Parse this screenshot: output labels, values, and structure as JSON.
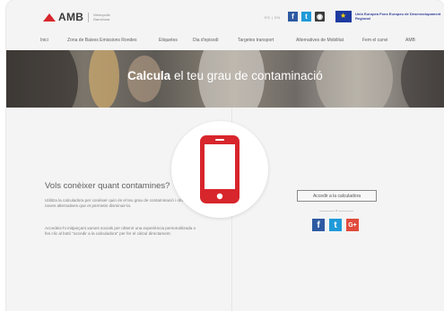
{
  "header": {
    "logo_text": "AMB",
    "logo_sub": "Metropolis Barcelona",
    "lang": "ES | EN",
    "eu_text": "Unió Europea Fons Europeu de Desenvolupament Regional"
  },
  "nav": {
    "items": [
      "Inici",
      "Zona de Baixes Emissions Rondes",
      "Etiquetes",
      "Dia d'episodi",
      "Targetes transport",
      "Alternatives de Mobilitat",
      "Fem el canvi",
      "AMB"
    ]
  },
  "hero": {
    "title_bold": "Calcula",
    "title_rest": " el teu grau de contaminació"
  },
  "content": {
    "title": "Vols conèixer quant contamines?",
    "para1": "Utilitza la calculadora per conèixer quin és el teu grau de contaminació i obtenir noves alternatives que et permetin disminuir-la.",
    "para2": "Accedeix-hi mitjançant xarxes socials per obtenir una experiència personalitzada o fes clic al botó \"accedir a la calculadora\" per fer el càlcul directament.",
    "cta_label": "Accedir a la calculadora",
    "or_label": "o"
  },
  "social": {
    "facebook": "f",
    "twitter": "t",
    "googleplus": "G+"
  },
  "colors": {
    "accent": "#d7262c",
    "facebook": "#2e5aa2",
    "twitter": "#1f9ad8",
    "googleplus": "#e04b3d"
  }
}
